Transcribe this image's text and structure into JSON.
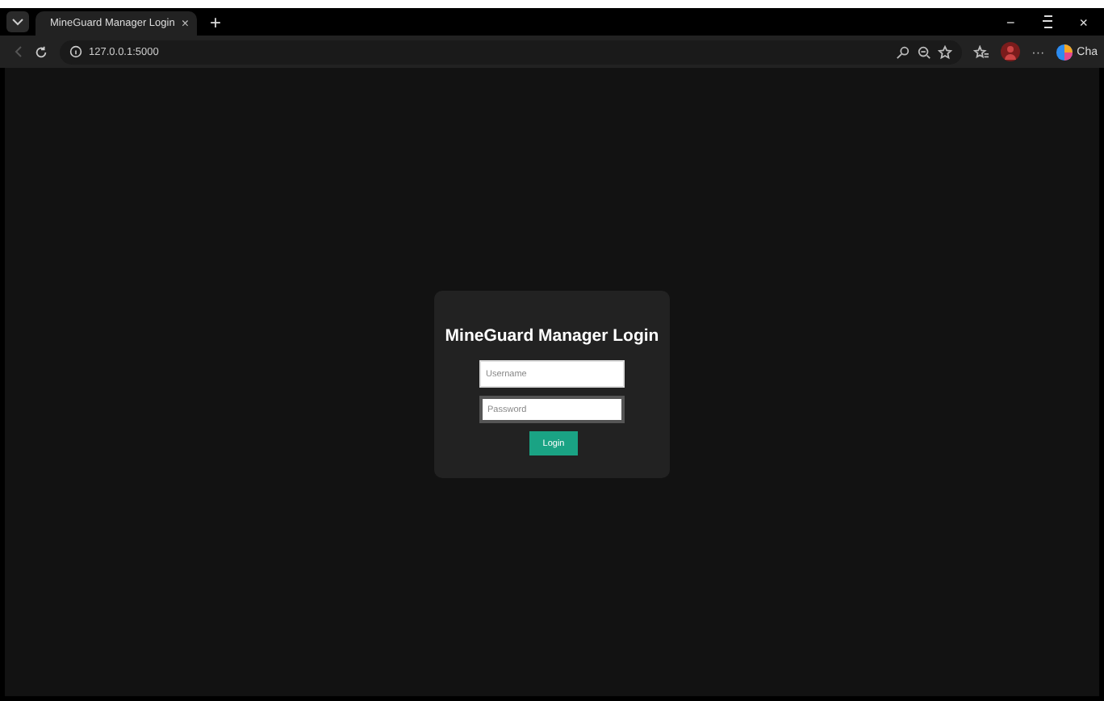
{
  "browser": {
    "tab": {
      "title": "MineGuard Manager Login",
      "close": "×"
    },
    "new_tab": "+",
    "url": "127.0.0.1:5000",
    "window_controls": [
      "−",
      "×"
    ],
    "more": "···",
    "copilot_label": "Cha"
  },
  "login": {
    "title": "MineGuard Manager Login",
    "username": {
      "placeholder": "Username"
    },
    "password": {
      "placeholder": "Password"
    },
    "button": "Login"
  }
}
